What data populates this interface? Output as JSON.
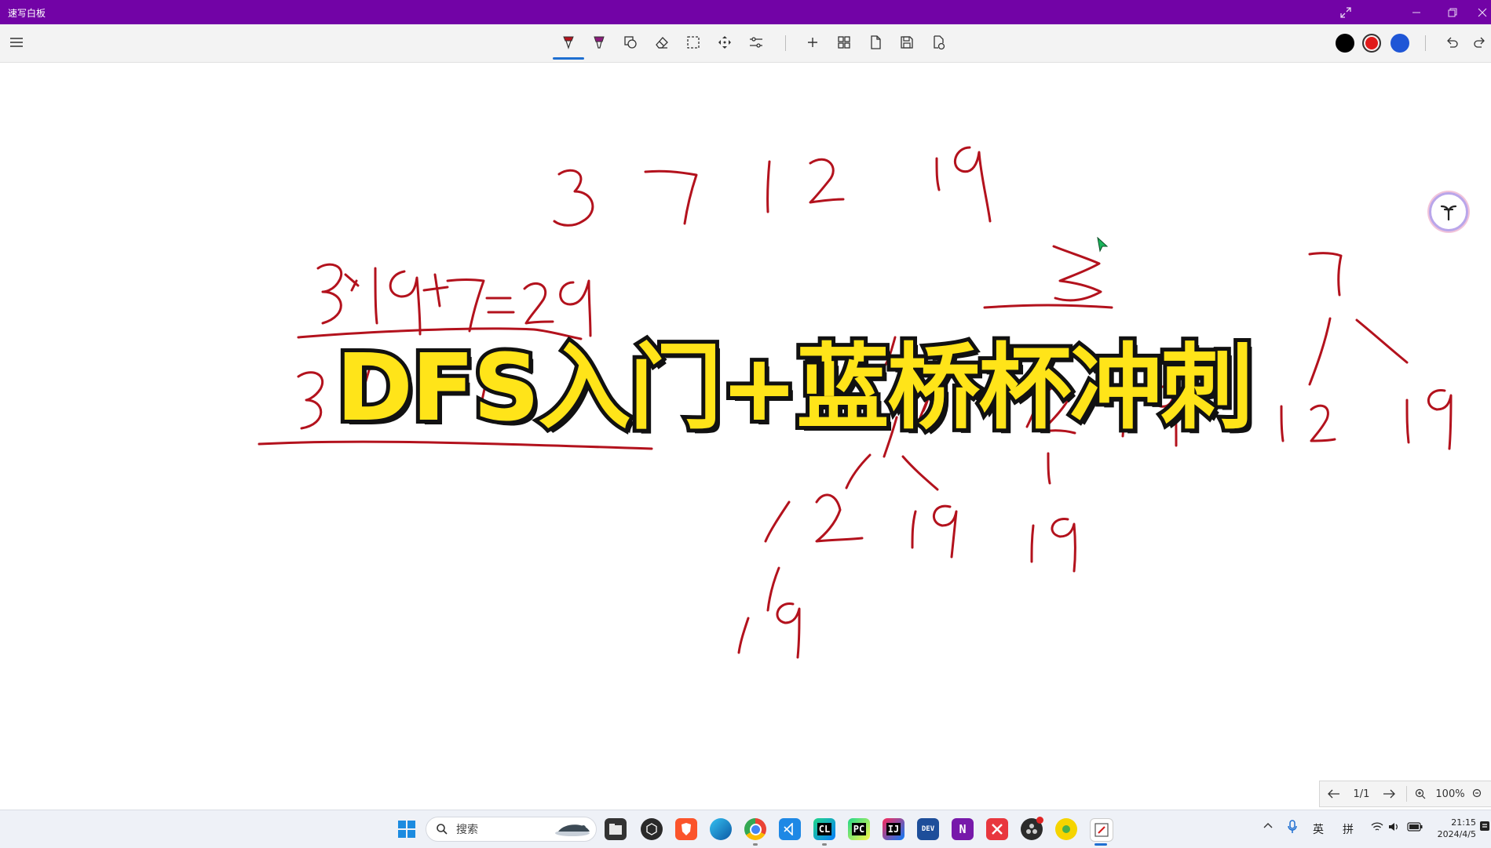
{
  "window": {
    "title": "速写白板",
    "controls": [
      "expand-icon",
      "minimize-icon",
      "restore-icon",
      "close-icon"
    ]
  },
  "toolbar": {
    "tools": [
      "pen-icon",
      "highlighter-icon",
      "shapes-icon",
      "eraser-icon",
      "lasso-select-icon",
      "pan-icon",
      "settings-sliders-icon"
    ],
    "actions": [
      "add-icon",
      "grid-icon",
      "page-icon",
      "save-icon",
      "export-icon"
    ],
    "colors": {
      "black": "#000000",
      "red": "#e11a1a",
      "blue": "#1f56d6",
      "selected": "red"
    },
    "history": [
      "undo-icon",
      "redo-icon"
    ]
  },
  "canvas": {
    "overlay_title": "DFS入门+蓝桥杯冲刺",
    "ink_color": "#b3121d"
  },
  "pager": {
    "page": "1/1",
    "zoom": "100%"
  },
  "taskbar": {
    "search_placeholder": "搜索",
    "apps": [
      "windows-start-icon",
      "file-explorer-icon",
      "unity-icon",
      "brave-icon",
      "edge-icon",
      "chrome-icon",
      "vscode-icon",
      "clion-icon",
      "pycharm-icon",
      "intellij-icon",
      "devcpp-icon",
      "onenote-icon",
      "xmind-icon",
      "obs-icon",
      "wechat-icon",
      "whiteboard-icon"
    ],
    "devcpp_label": "DEV",
    "clion_label": "CL",
    "pycharm_label": "PC",
    "intellij_label": "IJ",
    "onenote_label": "N",
    "ime_lang": "英",
    "ime_mode": "拼",
    "time": "21:15",
    "date": "2024/4/5"
  }
}
